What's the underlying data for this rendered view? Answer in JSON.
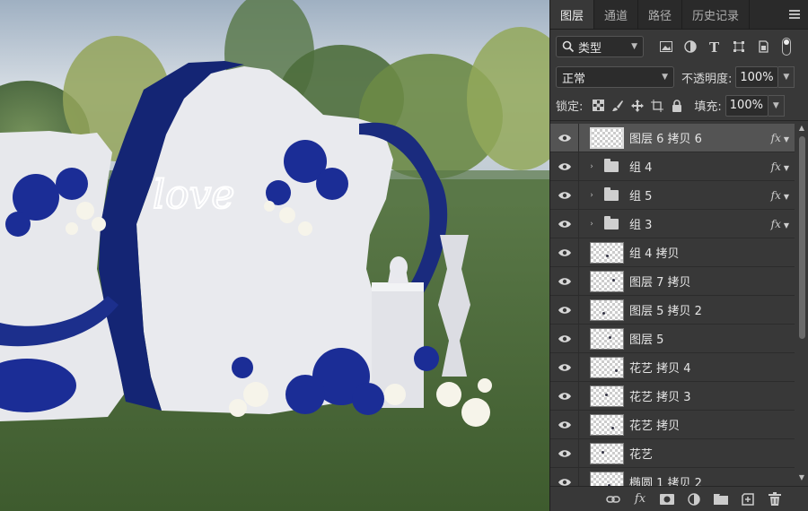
{
  "panel": {
    "tabs": [
      {
        "label": "图层",
        "active": true
      },
      {
        "label": "通道"
      },
      {
        "label": "路径"
      },
      {
        "label": "历史记录"
      }
    ],
    "filter": {
      "value": "类型"
    },
    "blend_mode": "正常",
    "opacity_label": "不透明度:",
    "opacity_value": "100%",
    "lock_label": "锁定:",
    "fill_label": "填充:",
    "fill_value": "100%",
    "layers": [
      {
        "name": "图层 6 拷贝 6",
        "type": "layer",
        "selected": true,
        "fx": true
      },
      {
        "name": "组 4",
        "type": "group",
        "fx": true
      },
      {
        "name": "组 5",
        "type": "group",
        "fx": true
      },
      {
        "name": "组 3",
        "type": "group",
        "fx": true
      },
      {
        "name": "组 4 拷贝",
        "type": "layer"
      },
      {
        "name": "图层 7 拷贝",
        "type": "layer"
      },
      {
        "name": "图层 5 拷贝 2",
        "type": "layer"
      },
      {
        "name": "图层 5",
        "type": "layer"
      },
      {
        "name": "花艺 拷贝 4",
        "type": "layer"
      },
      {
        "name": "花艺 拷贝 3",
        "type": "layer"
      },
      {
        "name": "花艺 拷贝",
        "type": "layer"
      },
      {
        "name": "花艺",
        "type": "layer"
      },
      {
        "name": "椭圆 1 拷贝 2",
        "type": "layer"
      }
    ],
    "fx_label": "fx"
  },
  "canvas": {
    "sign_text": "love"
  },
  "colors": {
    "panel_bg": "#383838",
    "tab_bar": "#2a2a2a",
    "selected_row": "#545454",
    "royal_blue": "#1c2f8c"
  }
}
